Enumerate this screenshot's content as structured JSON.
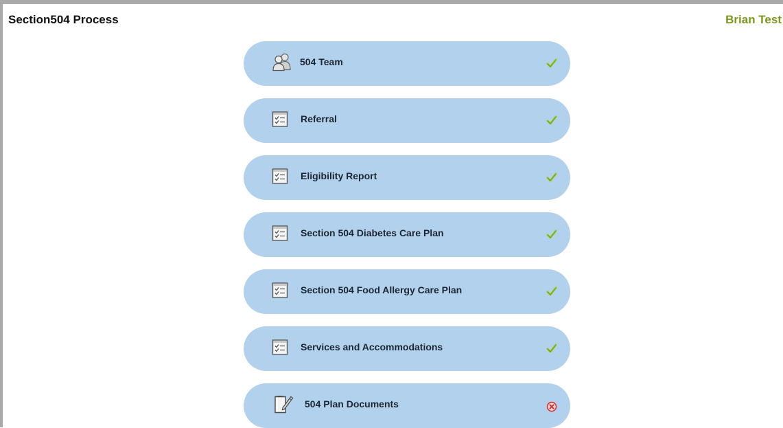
{
  "header": {
    "title": "Section504 Process",
    "user": "Brian Test"
  },
  "steps": [
    {
      "label": "504 Team",
      "icon": "team-icon",
      "status": "complete"
    },
    {
      "label": "Referral",
      "icon": "checklist-icon",
      "status": "complete"
    },
    {
      "label": "Eligibility Report",
      "icon": "checklist-icon",
      "status": "complete"
    },
    {
      "label": "Section 504 Diabetes Care Plan",
      "icon": "checklist-icon",
      "status": "complete"
    },
    {
      "label": "Section 504 Food Allergy Care Plan",
      "icon": "checklist-icon",
      "status": "complete"
    },
    {
      "label": "Services and Accommodations",
      "icon": "checklist-icon",
      "status": "complete"
    },
    {
      "label": "504 Plan Documents",
      "icon": "document-edit-icon",
      "status": "incomplete"
    }
  ],
  "colors": {
    "step_background": "#b2d1ec",
    "user_name": "#7a9a1a",
    "check": "#9acd32",
    "error": "#d9262a"
  }
}
